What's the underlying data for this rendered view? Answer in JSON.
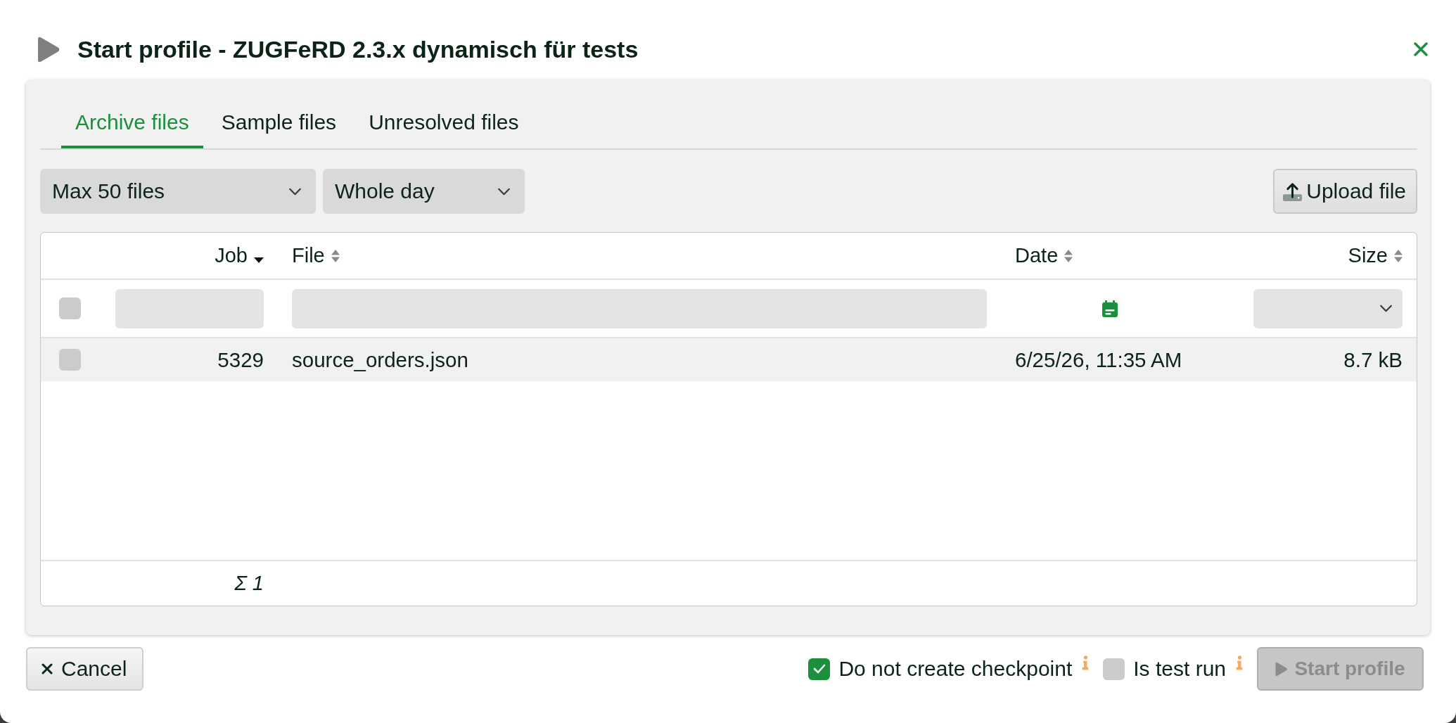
{
  "dialog": {
    "title": "Start profile - ZUGFeRD 2.3.x dynamisch für tests"
  },
  "tabs": [
    {
      "label": "Archive files",
      "selected": true
    },
    {
      "label": "Sample files",
      "selected": false
    },
    {
      "label": "Unresolved files",
      "selected": false
    }
  ],
  "toolbar": {
    "dropdowns": [
      {
        "value": "Max 50 files"
      },
      {
        "value": "Whole day"
      }
    ],
    "upload_button": "Upload file"
  },
  "table": {
    "columns": [
      {
        "label": "Job",
        "sorted": true
      },
      {
        "label": "File",
        "sorted": false
      },
      {
        "label": "Date",
        "sorted": false
      },
      {
        "label": "Size",
        "sorted": false
      }
    ],
    "filters": [
      {
        "kind": "text"
      },
      {
        "kind": "text"
      },
      {
        "kind": "date"
      },
      {
        "kind": "select"
      }
    ],
    "select_all": {
      "checked": false
    },
    "rows": [
      {
        "checked": false,
        "highlighted": true,
        "cells": [
          "5329",
          "source_orders.json",
          "6/25/26, 11:35 AM",
          "8.7 kB"
        ]
      }
    ],
    "footer": {
      "count": "Σ 1"
    }
  },
  "footer": {
    "cancel_button": "Cancel",
    "options": [
      {
        "label": "Do not create checkpoint",
        "checked": true
      },
      {
        "label": "Is test run",
        "checked": false
      }
    ],
    "start_button": {
      "label": "Start profile",
      "disabled": true
    }
  }
}
